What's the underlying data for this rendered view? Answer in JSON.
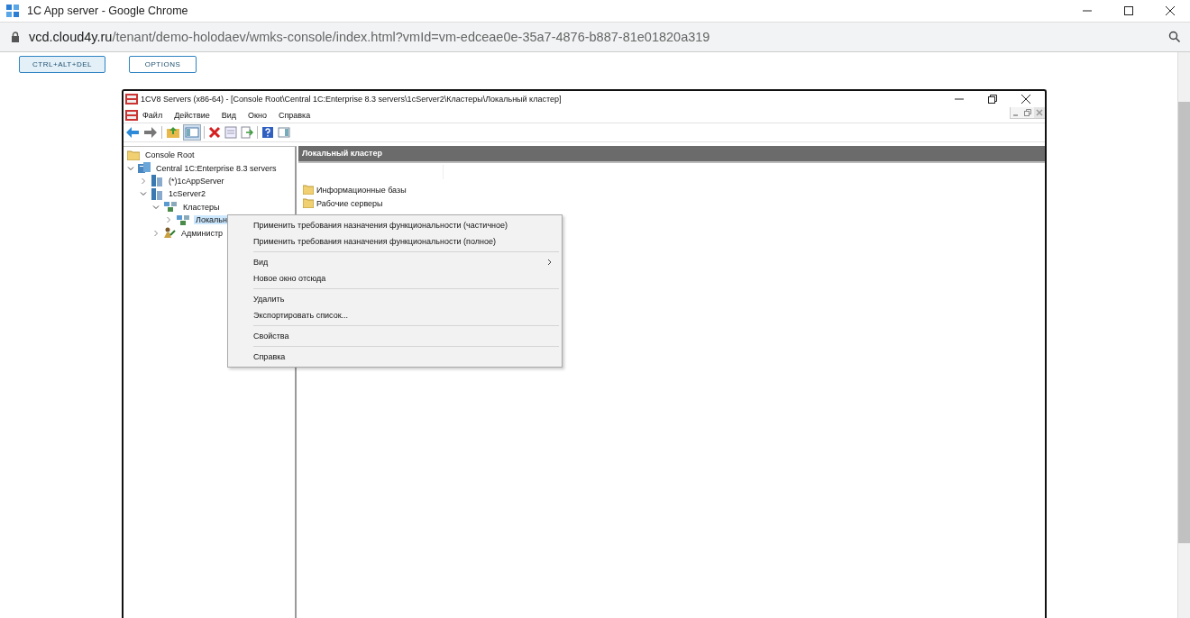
{
  "browser": {
    "title": "1C App server - Google Chrome",
    "url_host": "vcd.cloud4y.ru",
    "url_path": "/tenant/demo-holodaev/wmks-console/index.html?vmId=vm-edceae0e-35a7-4876-b887-81e01820a319"
  },
  "console_buttons": [
    {
      "label": "CTRL+ALT+DEL",
      "selected": true
    },
    {
      "label": "OPTIONS",
      "selected": false
    }
  ],
  "mmc": {
    "title": "1CV8 Servers (x86-64) - [Console Root\\Central 1C:Enterprise 8.3 servers\\1cServer2\\Кластеры\\Локальный кластер]",
    "menu": [
      "Файл",
      "Действие",
      "Вид",
      "Окно",
      "Справка"
    ],
    "tree_root": "Console Root",
    "tree": [
      {
        "label": "Central 1C:Enterprise 8.3 servers",
        "kind": "server-group",
        "expanded": true,
        "selected": false,
        "children": [
          {
            "label": "(*)1cAppServer",
            "kind": "server",
            "expanded": false,
            "selected": false
          },
          {
            "label": "1cServer2",
            "kind": "server",
            "expanded": true,
            "selected": false,
            "children": [
              {
                "label": "Кластеры",
                "kind": "cluster",
                "expanded": true,
                "selected": false,
                "children": [
                  {
                    "label": "Локальн",
                    "kind": "cluster",
                    "expanded": false,
                    "selected": true
                  }
                ]
              },
              {
                "label": "Администр",
                "kind": "admin",
                "expanded": false,
                "selected": false
              }
            ]
          }
        ]
      }
    ],
    "pane_title": "Локальный кластер",
    "pane_items": [
      "Информационные базы",
      "Рабочие серверы"
    ]
  },
  "context_menu": [
    [
      {
        "label": "Применить требования назначения функциональности (частичное)",
        "submenu": false
      },
      {
        "label": "Применить требования назначения функциональности (полное)",
        "submenu": false
      }
    ],
    [
      {
        "label": "Вид",
        "submenu": true
      },
      {
        "label": "Новое окно отсюда",
        "submenu": false
      }
    ],
    [
      {
        "label": "Удалить",
        "submenu": false
      },
      {
        "label": "Экспортировать список...",
        "submenu": false
      }
    ],
    [
      {
        "label": "Свойства",
        "submenu": false
      }
    ],
    [
      {
        "label": "Справка",
        "submenu": false
      }
    ]
  ]
}
